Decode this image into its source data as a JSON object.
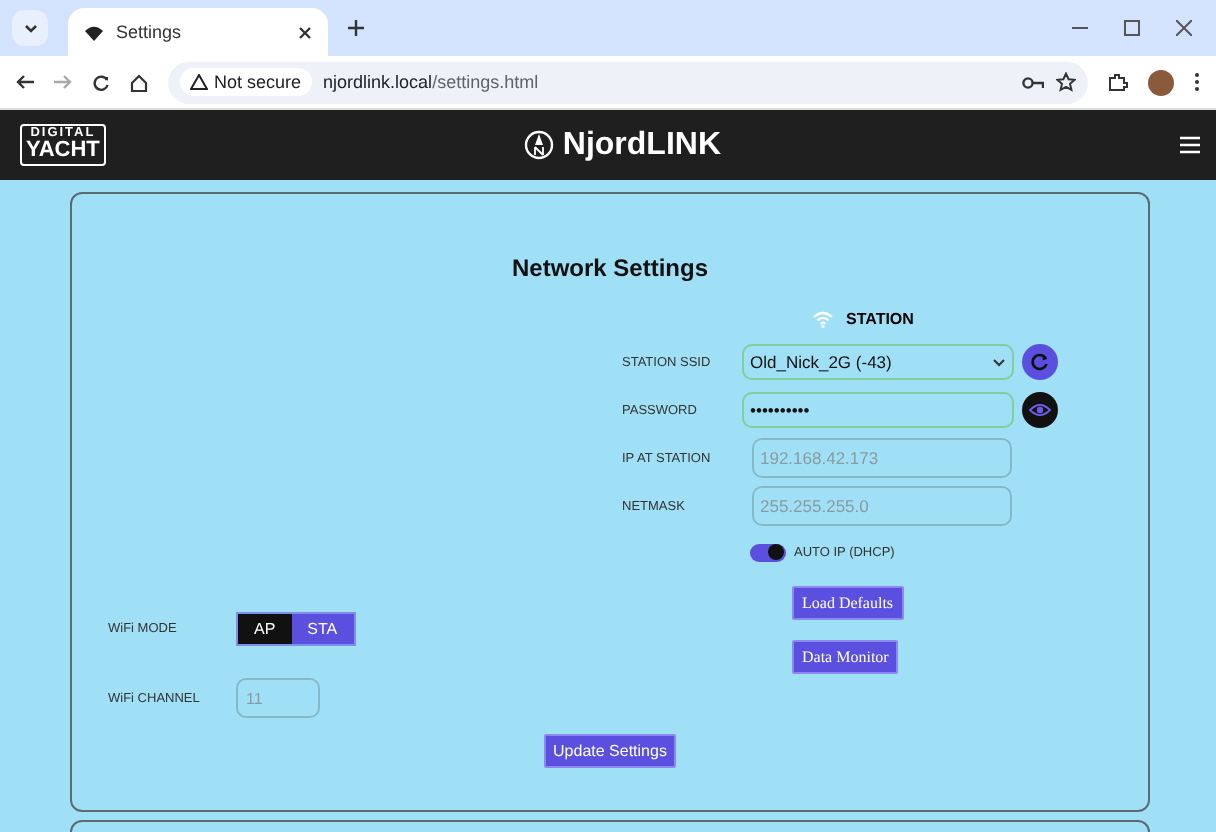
{
  "browser": {
    "tab_title": "Settings",
    "security": "Not secure",
    "url_host": "njordlink.local",
    "url_path": "/settings.html"
  },
  "header": {
    "logo_top": "DIGITAL",
    "logo_bottom": "YACHT",
    "title": "NjordLINK"
  },
  "panel": {
    "title": "Network Settings",
    "section": "STATION",
    "fields": [
      {
        "kind": "select",
        "label": "STATION SSID",
        "value": "Old_Nick_2G (-43)"
      },
      {
        "kind": "password",
        "label": "PASSWORD",
        "value": "••••••••••"
      },
      {
        "kind": "text",
        "label": "IP AT STATION",
        "placeholder": "192.168.42.173"
      },
      {
        "kind": "text",
        "label": "NETMASK",
        "placeholder": "255.255.255.0"
      }
    ],
    "auto_ip": {
      "label": "AUTO IP (DHCP)",
      "on": true
    },
    "wifi_mode": {
      "label": "WiFi MODE",
      "options": [
        {
          "label": "AP",
          "selected": true
        },
        {
          "label": "STA",
          "selected": false
        }
      ]
    },
    "wifi_channel": {
      "label": "WiFi CHANNEL",
      "placeholder": "11"
    },
    "buttons": [
      "Load Defaults",
      "Data Monitor"
    ],
    "update_button": "Update Settings"
  }
}
